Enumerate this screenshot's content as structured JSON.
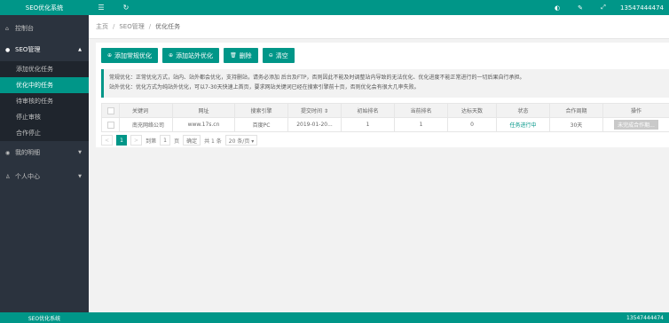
{
  "brand": "SEO优化系统",
  "topbar": {
    "menu_icon": "menu-icon",
    "refresh_icon": "refresh-icon",
    "user": "13547444474"
  },
  "sidebar": {
    "dashboard": "控制台",
    "seo_manage": "SEO管理",
    "sub_items": [
      "添加优化任务",
      "优化中的任务",
      "待审核的任务",
      "停止审核",
      "合作停止"
    ],
    "my_account": "我的明细",
    "personal": "个人中心"
  },
  "breadcrumb": {
    "home": "主页",
    "seo": "SEO管理",
    "current": "优化任务"
  },
  "buttons": {
    "add_normal": "添加常规优化",
    "add_site": "添加站外优化",
    "delete": "删除",
    "clear": "清空"
  },
  "notice": {
    "line1": "常规优化：正常优化方式，站内、站外都会优化，支持删站，请务必添加 后台及FTP，否则因此不能及时调整站内导致的无法优化、优化进度不能正常进行的一切后果自行承担。",
    "line2": "站外优化：优化方式为纯站外优化，可以7-30天快速上首页，要求网站关键词已经在搜索引擎前十页，否则优化会有很大几率失败。"
  },
  "table": {
    "headers": [
      "关键词",
      "网址",
      "搜索引擎",
      "提交时间 ⇕",
      "初始排名",
      "当前排名",
      "达标天数",
      "状态",
      "合作周期",
      "操作"
    ],
    "rows": [
      [
        "南充网络公司",
        "www.17s.cn",
        "百度PC",
        "2019-01-20...",
        "1",
        "1",
        "0",
        "任务进行中",
        "30天",
        "未完成合作期..."
      ]
    ]
  },
  "pager": {
    "prev": "<",
    "page": "1",
    "next": ">",
    "goto": "到第",
    "input": "1",
    "page_unit": "页",
    "confirm": "确定",
    "total": "共 1 条",
    "per_page": "20 条/页 ▾"
  },
  "footer": {
    "left": "SEO优化系统",
    "right": "13547444474"
  }
}
